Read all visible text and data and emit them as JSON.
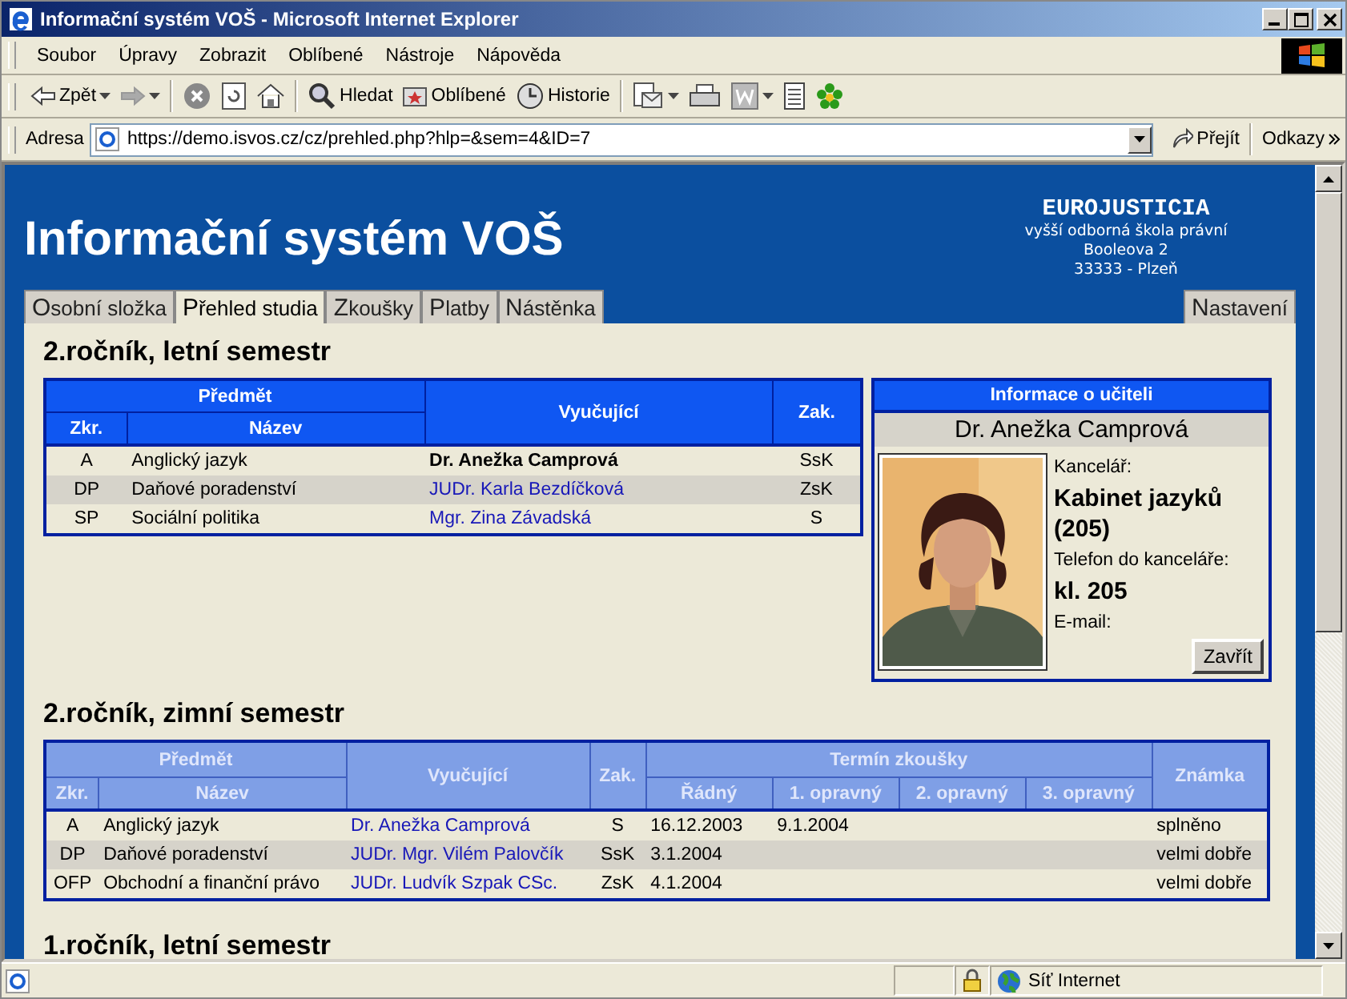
{
  "window": {
    "title": "Informační systém VOŠ - Microsoft Internet Explorer"
  },
  "menu": [
    "Soubor",
    "Úpravy",
    "Zobrazit",
    "Oblíbené",
    "Nástroje",
    "Nápověda"
  ],
  "toolbar": [
    {
      "kind": "back",
      "label": "Zpět",
      "dropdown": true
    },
    {
      "kind": "forward",
      "dropdown": true
    },
    {
      "kind": "stop",
      "dropdown": false
    },
    {
      "kind": "refresh",
      "dropdown": false
    },
    {
      "kind": "home",
      "dropdown": false
    },
    {
      "kind": "search",
      "label": "Hledat",
      "dropdown": false
    },
    {
      "kind": "favorites",
      "label": "Oblíbené",
      "dropdown": false
    },
    {
      "kind": "history",
      "label": "Historie",
      "dropdown": false
    },
    {
      "kind": "mail",
      "dropdown": true
    },
    {
      "kind": "print",
      "dropdown": false
    },
    {
      "kind": "word",
      "dropdown": true
    },
    {
      "kind": "notes",
      "dropdown": false
    },
    {
      "kind": "messenger",
      "dropdown": false
    }
  ],
  "address": {
    "label": "Adresa",
    "url": "https://demo.isvos.cz/cz/prehled.php?hlp=&sem=4&ID=7",
    "go": "Přejít",
    "links": "Odkazy"
  },
  "page": {
    "title": "Informační systém VOŠ",
    "school": {
      "name": "EUROJUSTICIA",
      "lines": [
        "vyšší odborná škola právní",
        "Booleova 2",
        "33333 - Plzeň"
      ]
    },
    "tabs": [
      {
        "label": "Osobní složka",
        "selected": false
      },
      {
        "label": "Přehled studia",
        "selected": true
      },
      {
        "label": "Zkoušky",
        "selected": false
      },
      {
        "label": "Platby",
        "selected": false
      },
      {
        "label": "Nástěnka",
        "selected": false
      }
    ],
    "settings_tab": {
      "label": "Nastavení",
      "selected": false
    }
  },
  "semesters": [
    {
      "kind": "teachers",
      "heading": "2.ročník, letní semestr",
      "active": true,
      "header": {
        "subject": "Předmět",
        "code": "Zkr.",
        "name": "Název",
        "teacher": "Vyučující",
        "credit": "Zak."
      },
      "rows": [
        {
          "code": "A",
          "name": "Anglický jazyk",
          "teacher": "Dr. Anežka Camprová",
          "teacher_selected": true,
          "credit": "SsK"
        },
        {
          "code": "DP",
          "name": "Daňové poradenství",
          "teacher": "JUDr. Karla Bezdíčková",
          "teacher_selected": false,
          "credit": "ZsK"
        },
        {
          "code": "SP",
          "name": "Sociální politika",
          "teacher": "Mgr. Zina Závadská",
          "teacher_selected": false,
          "credit": "S"
        }
      ]
    },
    {
      "kind": "exams",
      "heading": "2.ročník, zimní semestr",
      "active": false,
      "header": {
        "subject": "Předmět",
        "code": "Zkr.",
        "name": "Název",
        "teacher": "Vyučující",
        "credit": "Zak.",
        "exam": "Termín zkoušky",
        "terms": [
          "Řádný",
          "1. opravný",
          "2. opravný",
          "3. opravný"
        ],
        "grade": "Známka"
      },
      "rows": [
        {
          "code": "A",
          "name": "Anglický jazyk",
          "teacher": "Dr. Anežka Camprová",
          "teacher_selected": false,
          "credit": "S",
          "dates": [
            "16.12.2003",
            "9.1.2004"
          ],
          "grade": "splněno"
        },
        {
          "code": "DP",
          "name": "Daňové poradenství",
          "teacher": "JUDr. Mgr. Vilém Palovčík",
          "teacher_selected": false,
          "credit": "SsK",
          "dates": [
            "3.1.2004"
          ],
          "grade": "velmi dobře"
        },
        {
          "code": "OFP",
          "name": "Obchodní a finanční právo",
          "teacher": "JUDr. Ludvík Szpak CSc.",
          "teacher_selected": false,
          "credit": "ZsK",
          "dates": [
            "4.1.2004"
          ],
          "grade": "velmi dobře"
        }
      ]
    },
    {
      "kind": "heading_only",
      "heading": "1.ročník, letní semestr"
    }
  ],
  "teacher_panel": {
    "title": "Informace o učiteli",
    "name": "Dr. Anežka Camprová",
    "fields": [
      {
        "label": "Kancelář:",
        "value": "Kabinet jazyků (205)"
      },
      {
        "label": "Telefon do kanceláře:",
        "value": "kl. 205"
      },
      {
        "label": "E-mail:"
      }
    ],
    "close": "Zavřít"
  },
  "status_bar": {
    "zone": "Síť Internet",
    "secure": true
  }
}
